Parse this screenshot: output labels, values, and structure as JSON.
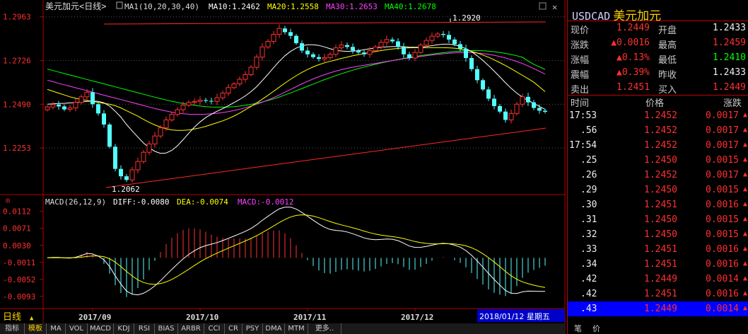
{
  "header": {
    "title": "美元加元<日线>",
    "ma_text": "MA1(10,20,30,40)",
    "ma10": "MA10:1.2462",
    "ma20": "MA20:1.2558",
    "ma30": "MA30:1.2653",
    "ma40": "MA40:1.2678",
    "colors": {
      "ma10": "#ffffff",
      "ma20": "#ffff00",
      "ma30": "#ff40ff",
      "ma40": "#00ff00",
      "up": "#ff3232",
      "down": "#54ffff"
    }
  },
  "macd_header": {
    "params": "MACD(26,12,9)",
    "diff": "DIFF:-0.0080",
    "dea": "DEA:-0.0074",
    "macd": "MACD:-0.0012"
  },
  "chart_data": {
    "type": "candlestick",
    "y_ticks": [
      "1.2963",
      "1.2726",
      "1.2490",
      "1.2253"
    ],
    "ylim": [
      1.202,
      1.2985
    ],
    "x_labels": [
      "2017/09",
      "2017/10",
      "2017/11",
      "2017/12"
    ],
    "date_label": "2018/01/12 星期五",
    "period_label": "日线",
    "annotations": {
      "high": "1.2920",
      "low": "1.2062"
    },
    "macd_y_ticks": [
      "0.0112",
      "0.0071",
      "0.0030",
      "-0.0011",
      "-0.0052",
      "-0.0093"
    ],
    "macd_ylim": [
      -0.0112,
      0.012
    ],
    "closes": [
      1.2475,
      1.2488,
      1.2478,
      1.2462,
      1.247,
      1.25,
      1.253,
      1.2555,
      1.249,
      1.244,
      1.238,
      1.226,
      1.214,
      1.21,
      1.208,
      1.2135,
      1.218,
      1.223,
      1.2275,
      1.2318,
      1.2362,
      1.2405,
      1.2435,
      1.246,
      1.2485,
      1.25,
      1.2505,
      1.2512,
      1.2508,
      1.2505,
      1.2525,
      1.255,
      1.258,
      1.26,
      1.2625,
      1.265,
      1.269,
      1.2745,
      1.28,
      1.283,
      1.2868,
      1.29,
      1.288,
      1.286,
      1.282,
      1.278,
      1.276,
      1.2745,
      1.2735,
      1.2742,
      1.276,
      1.2795,
      1.281,
      1.28,
      1.278,
      1.277,
      1.276,
      1.278,
      1.28,
      1.2825,
      1.284,
      1.283,
      1.28,
      1.276,
      1.274,
      1.277,
      1.281,
      1.2835,
      1.2858,
      1.287,
      1.2865,
      1.284,
      1.2815,
      1.279,
      1.274,
      1.268,
      1.262,
      1.257,
      1.252,
      1.248,
      1.245,
      1.2405,
      1.244,
      1.249,
      1.253,
      1.25,
      1.247,
      1.2455,
      1.2449
    ],
    "ma10": [
      1.249,
      1.2492,
      1.2494,
      1.2495,
      1.2497,
      1.2499,
      1.2502,
      1.2505,
      1.2507,
      1.2505,
      1.2498,
      1.248,
      1.2452,
      1.242,
      1.238,
      1.2345,
      1.2312,
      1.228,
      1.2255,
      1.2235,
      1.2224,
      1.2226,
      1.224,
      1.2265,
      1.2298,
      1.2333,
      1.2366,
      1.2394,
      1.2418,
      1.2436,
      1.2452,
      1.2466,
      1.2482,
      1.2499,
      1.2516,
      1.2535,
      1.2558,
      1.2585,
      1.2618,
      1.2652,
      1.2688,
      1.2722,
      1.2752,
      1.2776,
      1.2794,
      1.2806,
      1.2812,
      1.2812,
      1.2808,
      1.28,
      1.279,
      1.2782,
      1.2778,
      1.2776,
      1.2777,
      1.278,
      1.2785,
      1.279,
      1.2794,
      1.2798,
      1.28,
      1.2802,
      1.2802,
      1.2801,
      1.2799,
      1.2798,
      1.2799,
      1.2802,
      1.2807,
      1.2812,
      1.2815,
      1.2815,
      1.2811,
      1.2803,
      1.2791,
      1.2774,
      1.2752,
      1.2727,
      1.2699,
      1.2669,
      1.2638,
      1.2606,
      1.2576,
      1.255,
      1.2528,
      1.251,
      1.2495,
      1.2478,
      1.2462
    ],
    "ma20": [
      1.257,
      1.256,
      1.255,
      1.254,
      1.253,
      1.2522,
      1.2515,
      1.251,
      1.2505,
      1.25,
      1.2495,
      1.249,
      1.2482,
      1.247,
      1.2455,
      1.244,
      1.2425,
      1.2408,
      1.2392,
      1.2378,
      1.2366,
      1.2357,
      1.2351,
      1.2348,
      1.2348,
      1.2351,
      1.2356,
      1.2362,
      1.237,
      1.238,
      1.239,
      1.24,
      1.2412,
      1.2426,
      1.2442,
      1.246,
      1.2478,
      1.2497,
      1.2517,
      1.2538,
      1.256,
      1.2582,
      1.2604,
      1.2625,
      1.2644,
      1.2662,
      1.2678,
      1.2692,
      1.2704,
      1.2714,
      1.2722,
      1.273,
      1.2738,
      1.2745,
      1.2752,
      1.2758,
      1.2764,
      1.277,
      1.2775,
      1.278,
      1.2785,
      1.2789,
      1.2792,
      1.2794,
      1.2795,
      1.2796,
      1.2796,
      1.2796,
      1.2796,
      1.2796,
      1.2796,
      1.2795,
      1.2793,
      1.2789,
      1.2783,
      1.2776,
      1.2767,
      1.2756,
      1.2744,
      1.273,
      1.2715,
      1.2699,
      1.2682,
      1.2664,
      1.2646,
      1.2628,
      1.2609,
      1.2584,
      1.2558
    ],
    "ma30": [
      1.262,
      1.2612,
      1.2603,
      1.2595,
      1.2587,
      1.2579,
      1.2571,
      1.2563,
      1.2555,
      1.2547,
      1.2539,
      1.2531,
      1.2523,
      1.2515,
      1.2507,
      1.2499,
      1.2491,
      1.2483,
      1.2475,
      1.2467,
      1.246,
      1.2453,
      1.2447,
      1.2442,
      1.2438,
      1.2436,
      1.2435,
      1.2435,
      1.2436,
      1.2438,
      1.2441,
      1.2445,
      1.245,
      1.2456,
      1.2463,
      1.2471,
      1.248,
      1.249,
      1.2501,
      1.2513,
      1.2526,
      1.254,
      1.2555,
      1.257,
      1.2585,
      1.26,
      1.2614,
      1.2627,
      1.2639,
      1.265,
      1.266,
      1.2669,
      1.2677,
      1.2684,
      1.269,
      1.2696,
      1.2701,
      1.2706,
      1.2711,
      1.2716,
      1.2721,
      1.2726,
      1.2731,
      1.2736,
      1.274,
      1.2744,
      1.2748,
      1.2752,
      1.2756,
      1.276,
      1.2763,
      1.2766,
      1.2768,
      1.2769,
      1.277,
      1.2769,
      1.2767,
      1.2764,
      1.276,
      1.2755,
      1.2748,
      1.274,
      1.2731,
      1.2721,
      1.271,
      1.2697,
      1.2683,
      1.2668,
      1.2653
    ],
    "ma40": [
      1.268,
      1.2672,
      1.2664,
      1.2656,
      1.2648,
      1.264,
      1.2632,
      1.2624,
      1.2616,
      1.2608,
      1.26,
      1.2592,
      1.2584,
      1.2576,
      1.2568,
      1.256,
      1.2552,
      1.2544,
      1.2536,
      1.2528,
      1.252,
      1.2513,
      1.2506,
      1.25,
      1.2494,
      1.2489,
      1.2484,
      1.248,
      1.2477,
      1.2475,
      1.2474,
      1.2474,
      1.2475,
      1.2477,
      1.248,
      1.2484,
      1.2489,
      1.2495,
      1.2502,
      1.251,
      1.2519,
      1.2529,
      1.254,
      1.2551,
      1.2563,
      1.2575,
      1.2587,
      1.2599,
      1.2611,
      1.2623,
      1.2634,
      1.2645,
      1.2655,
      1.2665,
      1.2674,
      1.2683,
      1.2691,
      1.2699,
      1.2706,
      1.2713,
      1.272,
      1.2726,
      1.2732,
      1.2738,
      1.2743,
      1.2748,
      1.2753,
      1.2757,
      1.2761,
      1.2765,
      1.2769,
      1.2772,
      1.2775,
      1.2777,
      1.2779,
      1.278,
      1.278,
      1.2779,
      1.2777,
      1.2774,
      1.277,
      1.2765,
      1.2759,
      1.2752,
      1.2744,
      1.2724,
      1.2706,
      1.2692,
      1.2678
    ]
  },
  "panel": {
    "symbol": "USDCAD",
    "name": "美元加元",
    "quotes": [
      {
        "l1": "现价",
        "v1": "1.2449",
        "l2": "开盘",
        "v2": "1.2433"
      },
      {
        "l1": "涨跌",
        "v1": "▲0.0016",
        "l2": "最高",
        "v2": "1.2459"
      },
      {
        "l1": "涨幅",
        "v1": "▲0.13%",
        "l2": "最低",
        "v2": "1.2410"
      },
      {
        "l1": "震幅",
        "v1": "▲0.39%",
        "l2": "昨收",
        "v2": "1.2433"
      },
      {
        "l1": "卖出",
        "v1": "1.2451",
        "l2": "买入",
        "v2": "1.2449"
      }
    ],
    "tick_headers": [
      "时间",
      "价格",
      "涨跌"
    ],
    "ticks": [
      {
        "t": "17:53",
        "p": "1.2452",
        "c": "0.0017"
      },
      {
        "t": ".56",
        "p": "1.2452",
        "c": "0.0017"
      },
      {
        "t": "17:54",
        "p": "1.2452",
        "c": "0.0017"
      },
      {
        "t": ".25",
        "p": "1.2450",
        "c": "0.0015"
      },
      {
        "t": ".26",
        "p": "1.2452",
        "c": "0.0017"
      },
      {
        "t": ".29",
        "p": "1.2450",
        "c": "0.0015"
      },
      {
        "t": ".30",
        "p": "1.2451",
        "c": "0.0016"
      },
      {
        "t": ".31",
        "p": "1.2450",
        "c": "0.0015"
      },
      {
        "t": ".32",
        "p": "1.2450",
        "c": "0.0015"
      },
      {
        "t": ".33",
        "p": "1.2451",
        "c": "0.0016"
      },
      {
        "t": ".34",
        "p": "1.2451",
        "c": "0.0016"
      },
      {
        "t": ".42",
        "p": "1.2449",
        "c": "0.0014"
      },
      {
        "t": ".42",
        "p": "1.2451",
        "c": "0.0016"
      },
      {
        "t": ".43",
        "p": "1.2449",
        "c": "0.0014"
      }
    ],
    "bottom_tabs": [
      "笔",
      "价"
    ]
  },
  "tabs": [
    "指标",
    "模板",
    "MA",
    "VOL",
    "MACD",
    "KDJ",
    "RSI",
    "BIAS",
    "ARBR",
    "CCI",
    "CR",
    "PSY",
    "DMA",
    "MTM",
    "更多.."
  ]
}
